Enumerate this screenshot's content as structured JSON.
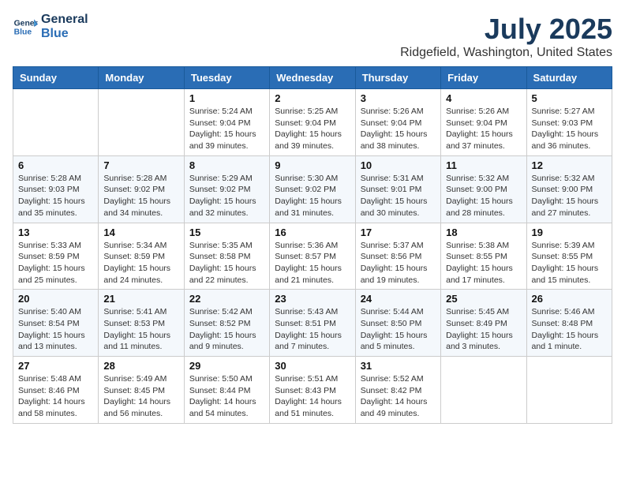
{
  "header": {
    "logo_line1": "General",
    "logo_line2": "Blue",
    "month": "July 2025",
    "location": "Ridgefield, Washington, United States"
  },
  "days_of_week": [
    "Sunday",
    "Monday",
    "Tuesday",
    "Wednesday",
    "Thursday",
    "Friday",
    "Saturday"
  ],
  "weeks": [
    [
      {
        "day": "",
        "info": ""
      },
      {
        "day": "",
        "info": ""
      },
      {
        "day": "1",
        "info": "Sunrise: 5:24 AM\nSunset: 9:04 PM\nDaylight: 15 hours and 39 minutes."
      },
      {
        "day": "2",
        "info": "Sunrise: 5:25 AM\nSunset: 9:04 PM\nDaylight: 15 hours and 39 minutes."
      },
      {
        "day": "3",
        "info": "Sunrise: 5:26 AM\nSunset: 9:04 PM\nDaylight: 15 hours and 38 minutes."
      },
      {
        "day": "4",
        "info": "Sunrise: 5:26 AM\nSunset: 9:04 PM\nDaylight: 15 hours and 37 minutes."
      },
      {
        "day": "5",
        "info": "Sunrise: 5:27 AM\nSunset: 9:03 PM\nDaylight: 15 hours and 36 minutes."
      }
    ],
    [
      {
        "day": "6",
        "info": "Sunrise: 5:28 AM\nSunset: 9:03 PM\nDaylight: 15 hours and 35 minutes."
      },
      {
        "day": "7",
        "info": "Sunrise: 5:28 AM\nSunset: 9:02 PM\nDaylight: 15 hours and 34 minutes."
      },
      {
        "day": "8",
        "info": "Sunrise: 5:29 AM\nSunset: 9:02 PM\nDaylight: 15 hours and 32 minutes."
      },
      {
        "day": "9",
        "info": "Sunrise: 5:30 AM\nSunset: 9:02 PM\nDaylight: 15 hours and 31 minutes."
      },
      {
        "day": "10",
        "info": "Sunrise: 5:31 AM\nSunset: 9:01 PM\nDaylight: 15 hours and 30 minutes."
      },
      {
        "day": "11",
        "info": "Sunrise: 5:32 AM\nSunset: 9:00 PM\nDaylight: 15 hours and 28 minutes."
      },
      {
        "day": "12",
        "info": "Sunrise: 5:32 AM\nSunset: 9:00 PM\nDaylight: 15 hours and 27 minutes."
      }
    ],
    [
      {
        "day": "13",
        "info": "Sunrise: 5:33 AM\nSunset: 8:59 PM\nDaylight: 15 hours and 25 minutes."
      },
      {
        "day": "14",
        "info": "Sunrise: 5:34 AM\nSunset: 8:59 PM\nDaylight: 15 hours and 24 minutes."
      },
      {
        "day": "15",
        "info": "Sunrise: 5:35 AM\nSunset: 8:58 PM\nDaylight: 15 hours and 22 minutes."
      },
      {
        "day": "16",
        "info": "Sunrise: 5:36 AM\nSunset: 8:57 PM\nDaylight: 15 hours and 21 minutes."
      },
      {
        "day": "17",
        "info": "Sunrise: 5:37 AM\nSunset: 8:56 PM\nDaylight: 15 hours and 19 minutes."
      },
      {
        "day": "18",
        "info": "Sunrise: 5:38 AM\nSunset: 8:55 PM\nDaylight: 15 hours and 17 minutes."
      },
      {
        "day": "19",
        "info": "Sunrise: 5:39 AM\nSunset: 8:55 PM\nDaylight: 15 hours and 15 minutes."
      }
    ],
    [
      {
        "day": "20",
        "info": "Sunrise: 5:40 AM\nSunset: 8:54 PM\nDaylight: 15 hours and 13 minutes."
      },
      {
        "day": "21",
        "info": "Sunrise: 5:41 AM\nSunset: 8:53 PM\nDaylight: 15 hours and 11 minutes."
      },
      {
        "day": "22",
        "info": "Sunrise: 5:42 AM\nSunset: 8:52 PM\nDaylight: 15 hours and 9 minutes."
      },
      {
        "day": "23",
        "info": "Sunrise: 5:43 AM\nSunset: 8:51 PM\nDaylight: 15 hours and 7 minutes."
      },
      {
        "day": "24",
        "info": "Sunrise: 5:44 AM\nSunset: 8:50 PM\nDaylight: 15 hours and 5 minutes."
      },
      {
        "day": "25",
        "info": "Sunrise: 5:45 AM\nSunset: 8:49 PM\nDaylight: 15 hours and 3 minutes."
      },
      {
        "day": "26",
        "info": "Sunrise: 5:46 AM\nSunset: 8:48 PM\nDaylight: 15 hours and 1 minute."
      }
    ],
    [
      {
        "day": "27",
        "info": "Sunrise: 5:48 AM\nSunset: 8:46 PM\nDaylight: 14 hours and 58 minutes."
      },
      {
        "day": "28",
        "info": "Sunrise: 5:49 AM\nSunset: 8:45 PM\nDaylight: 14 hours and 56 minutes."
      },
      {
        "day": "29",
        "info": "Sunrise: 5:50 AM\nSunset: 8:44 PM\nDaylight: 14 hours and 54 minutes."
      },
      {
        "day": "30",
        "info": "Sunrise: 5:51 AM\nSunset: 8:43 PM\nDaylight: 14 hours and 51 minutes."
      },
      {
        "day": "31",
        "info": "Sunrise: 5:52 AM\nSunset: 8:42 PM\nDaylight: 14 hours and 49 minutes."
      },
      {
        "day": "",
        "info": ""
      },
      {
        "day": "",
        "info": ""
      }
    ]
  ]
}
